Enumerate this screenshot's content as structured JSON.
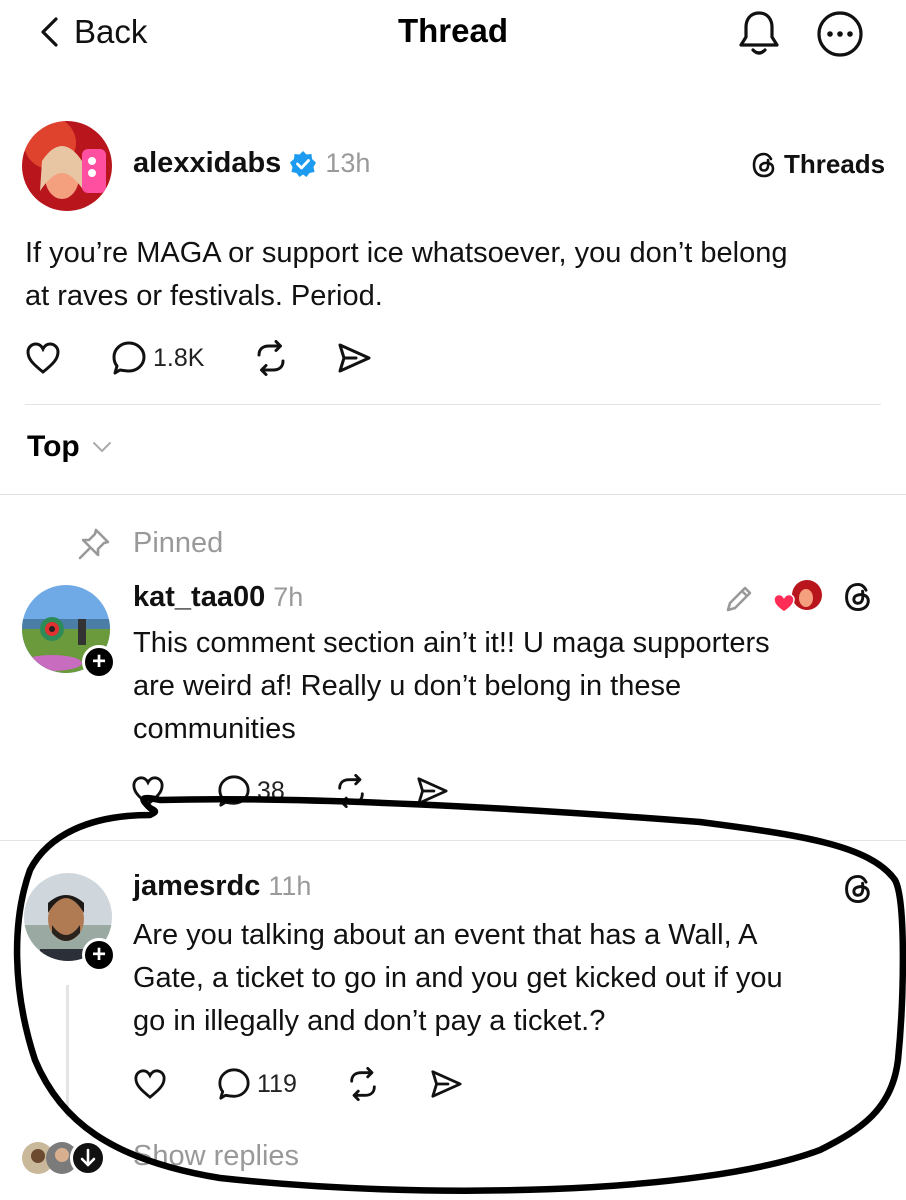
{
  "header": {
    "back_label": "Back",
    "title": "Thread"
  },
  "post": {
    "username": "alexxidabs",
    "time": "13h",
    "source_label": "Threads",
    "text_line1": "If you’re MAGA or support ice whatsoever, you don’t belong",
    "text_line2": "at raves or festivals. Period.",
    "reply_count": "1.8K"
  },
  "sort": {
    "label": "Top"
  },
  "pinned_label": "Pinned",
  "replies": [
    {
      "username": "kat_taa00",
      "time": "7h",
      "lines": [
        "This comment section ain’t it!! U maga supporters",
        "are weird af! Really u don’t belong in these",
        "communities"
      ],
      "reply_count": "38"
    },
    {
      "username": "jamesrdc",
      "time": "11h",
      "lines": [
        "Are you talking about an event that has a Wall, A",
        "Gate, a ticket to go in and you get kicked out if you",
        "go in illegally and don’t pay a ticket.?"
      ],
      "reply_count": "119"
    }
  ],
  "show_replies_label": "Show replies",
  "icons": [
    "chevron-left-icon",
    "bell-icon",
    "more-icon",
    "verified-icon",
    "threads-logo-icon",
    "heart-icon",
    "comment-icon",
    "repost-icon",
    "share-icon",
    "chevron-down-icon",
    "pin-icon",
    "pencil-icon",
    "arrow-down-icon"
  ],
  "colors": {
    "verified": "#1d9bf0",
    "heart_reaction": "#ff2d55",
    "muted_text": "#999999"
  }
}
